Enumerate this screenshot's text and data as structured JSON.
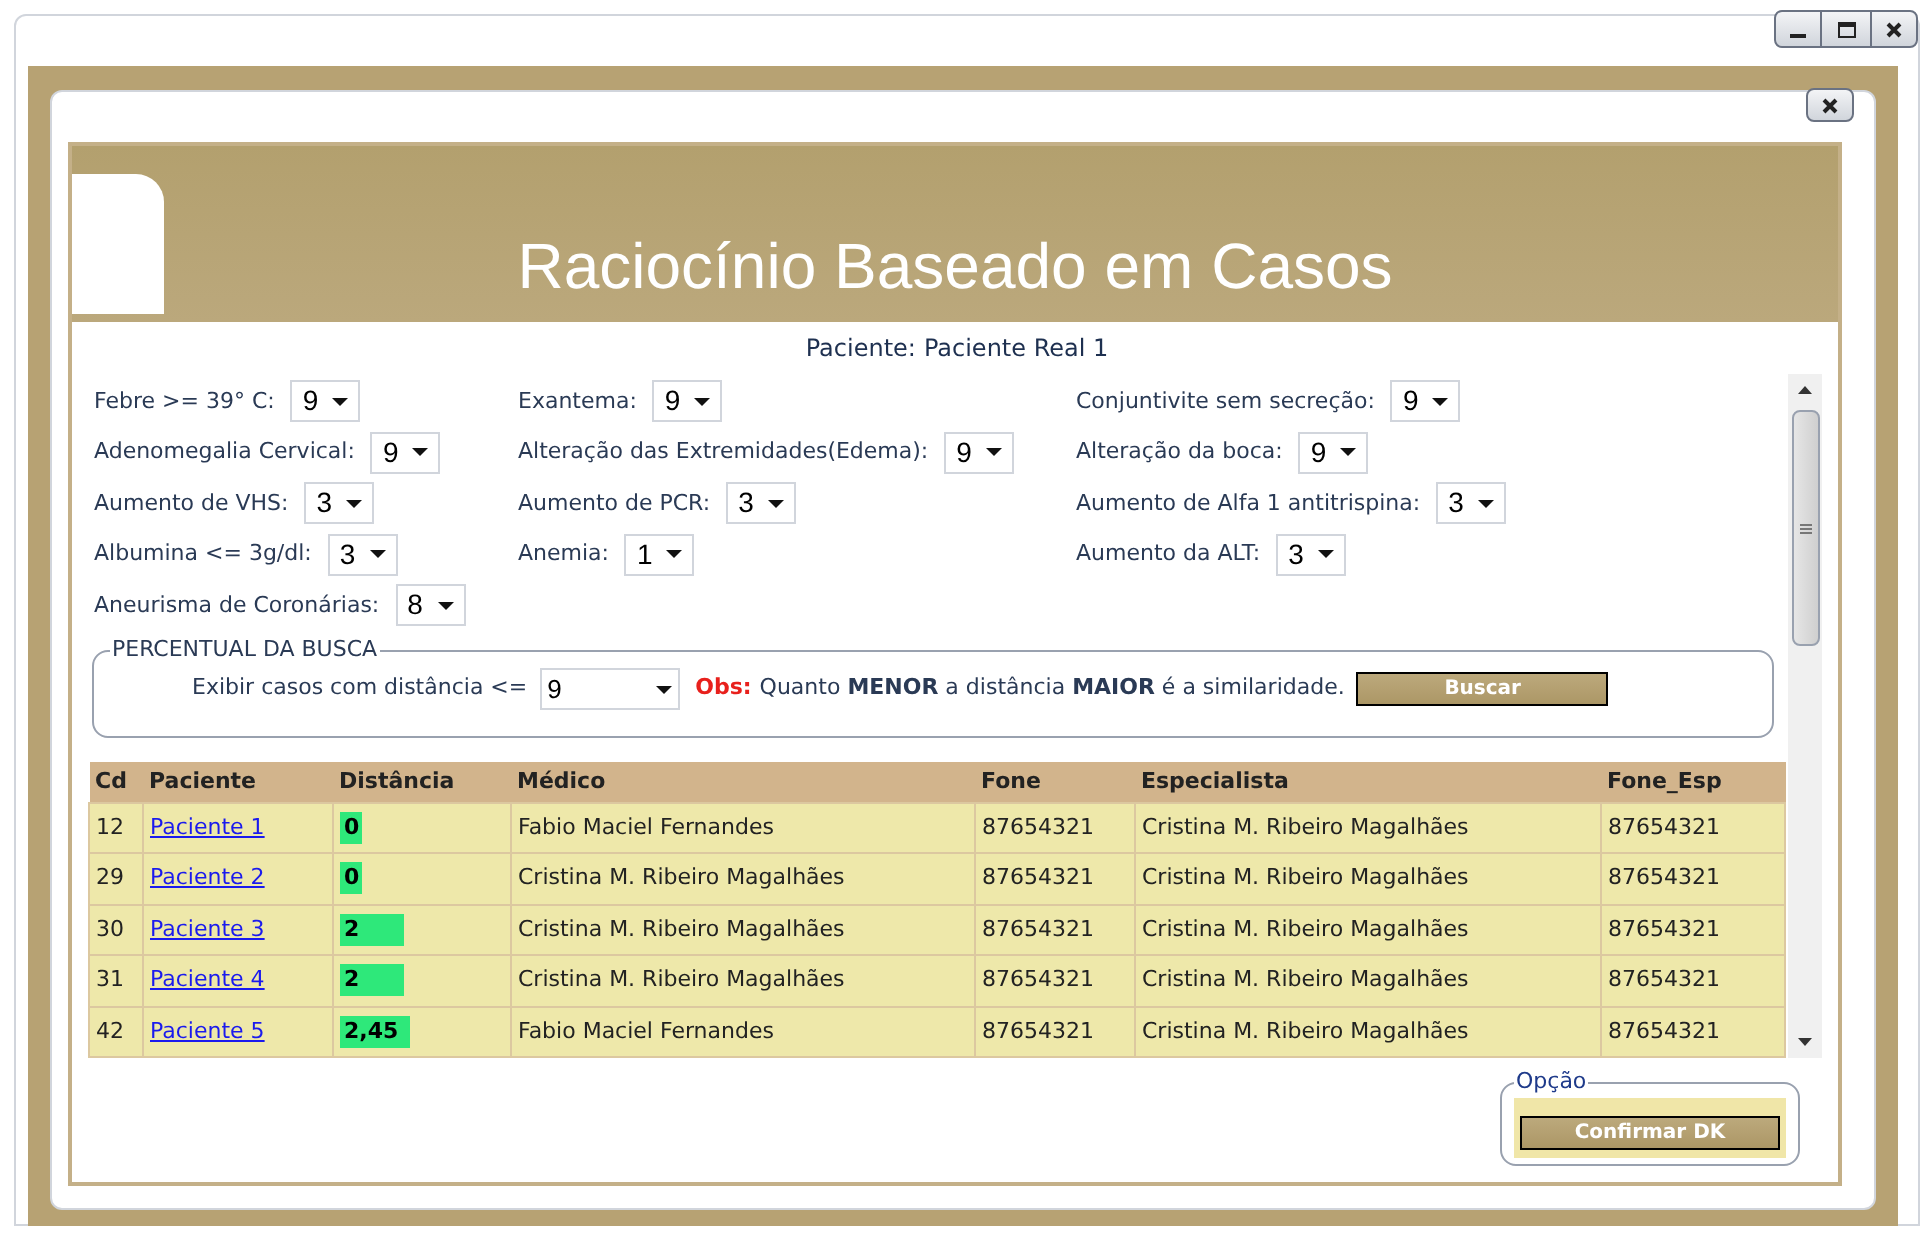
{
  "header": {
    "title": "Raciocínio Baseado em Casos"
  },
  "patient": {
    "label": "Paciente:",
    "value": "Paciente Real 1"
  },
  "criteria_columns": [
    [
      {
        "label": "Febre >= 39° C:",
        "value": "9"
      },
      {
        "label": "Adenomegalia Cervical:",
        "value": "9"
      },
      {
        "label": "Aumento de VHS:",
        "value": "3"
      },
      {
        "label": "Albumina <= 3g/dl:",
        "value": "3"
      },
      {
        "label": "Aneurisma de Coronárias:",
        "value": "8"
      }
    ],
    [
      {
        "label": "Exantema:",
        "value": "9"
      },
      {
        "label": "Alteração das Extremidades(Edema):",
        "value": "9"
      },
      {
        "label": "Aumento de PCR:",
        "value": "3"
      },
      {
        "label": "Anemia:",
        "value": "1"
      }
    ],
    [
      {
        "label": "Conjuntivite sem secreção:",
        "value": "9"
      },
      {
        "label": "Alteração da boca:",
        "value": "9"
      },
      {
        "label": "Aumento de Alfa 1 antitrispina:",
        "value": "3"
      },
      {
        "label": "Aumento da ALT:",
        "value": "3"
      }
    ]
  ],
  "search": {
    "legend": "PERCENTUAL DA BUSCA",
    "label": "Exibir casos com distância <=",
    "value": "9",
    "note_label": "Obs:",
    "note": "Quanto **MENOR** a distância **MAIOR** é a similaridade.",
    "button": "Buscar"
  },
  "table": {
    "columns": [
      "Cd",
      "Paciente",
      "Distância",
      "Médico",
      "Fone",
      "Especialista",
      "Fone_Esp"
    ],
    "rows": [
      {
        "cd": "12",
        "patient": "Paciente 1",
        "distance": "0",
        "level": 0.14,
        "doctor": "Fabio Maciel Fernandes",
        "phone": "87654321",
        "specialist": "Cristina M. Ribeiro Magalhães",
        "specialist_phone": "87654321"
      },
      {
        "cd": "29",
        "patient": "Paciente 2",
        "distance": "0",
        "level": 0.14,
        "doctor": "Cristina M. Ribeiro Magalhães",
        "phone": "87654321",
        "specialist": "Cristina M. Ribeiro Magalhães",
        "specialist_phone": "87654321"
      },
      {
        "cd": "30",
        "patient": "Paciente 3",
        "distance": "2",
        "level": 0.39,
        "doctor": "Cristina M. Ribeiro Magalhães",
        "phone": "87654321",
        "specialist": "Cristina M. Ribeiro Magalhães",
        "specialist_phone": "87654321"
      },
      {
        "cd": "31",
        "patient": "Paciente 4",
        "distance": "2",
        "level": 0.39,
        "doctor": "Cristina M. Ribeiro Magalhães",
        "phone": "87654321",
        "specialist": "Cristina M. Ribeiro Magalhães",
        "specialist_phone": "87654321"
      },
      {
        "cd": "42",
        "patient": "Paciente 5",
        "distance": "2,45",
        "level": 0.43,
        "doctor": "Fabio Maciel Fernandes",
        "phone": "87654321",
        "specialist": "Cristina M. Ribeiro Magalhães",
        "specialist_phone": "87654321"
      }
    ]
  },
  "options": {
    "legend": "Opção",
    "button": "Confirmar DK"
  }
}
